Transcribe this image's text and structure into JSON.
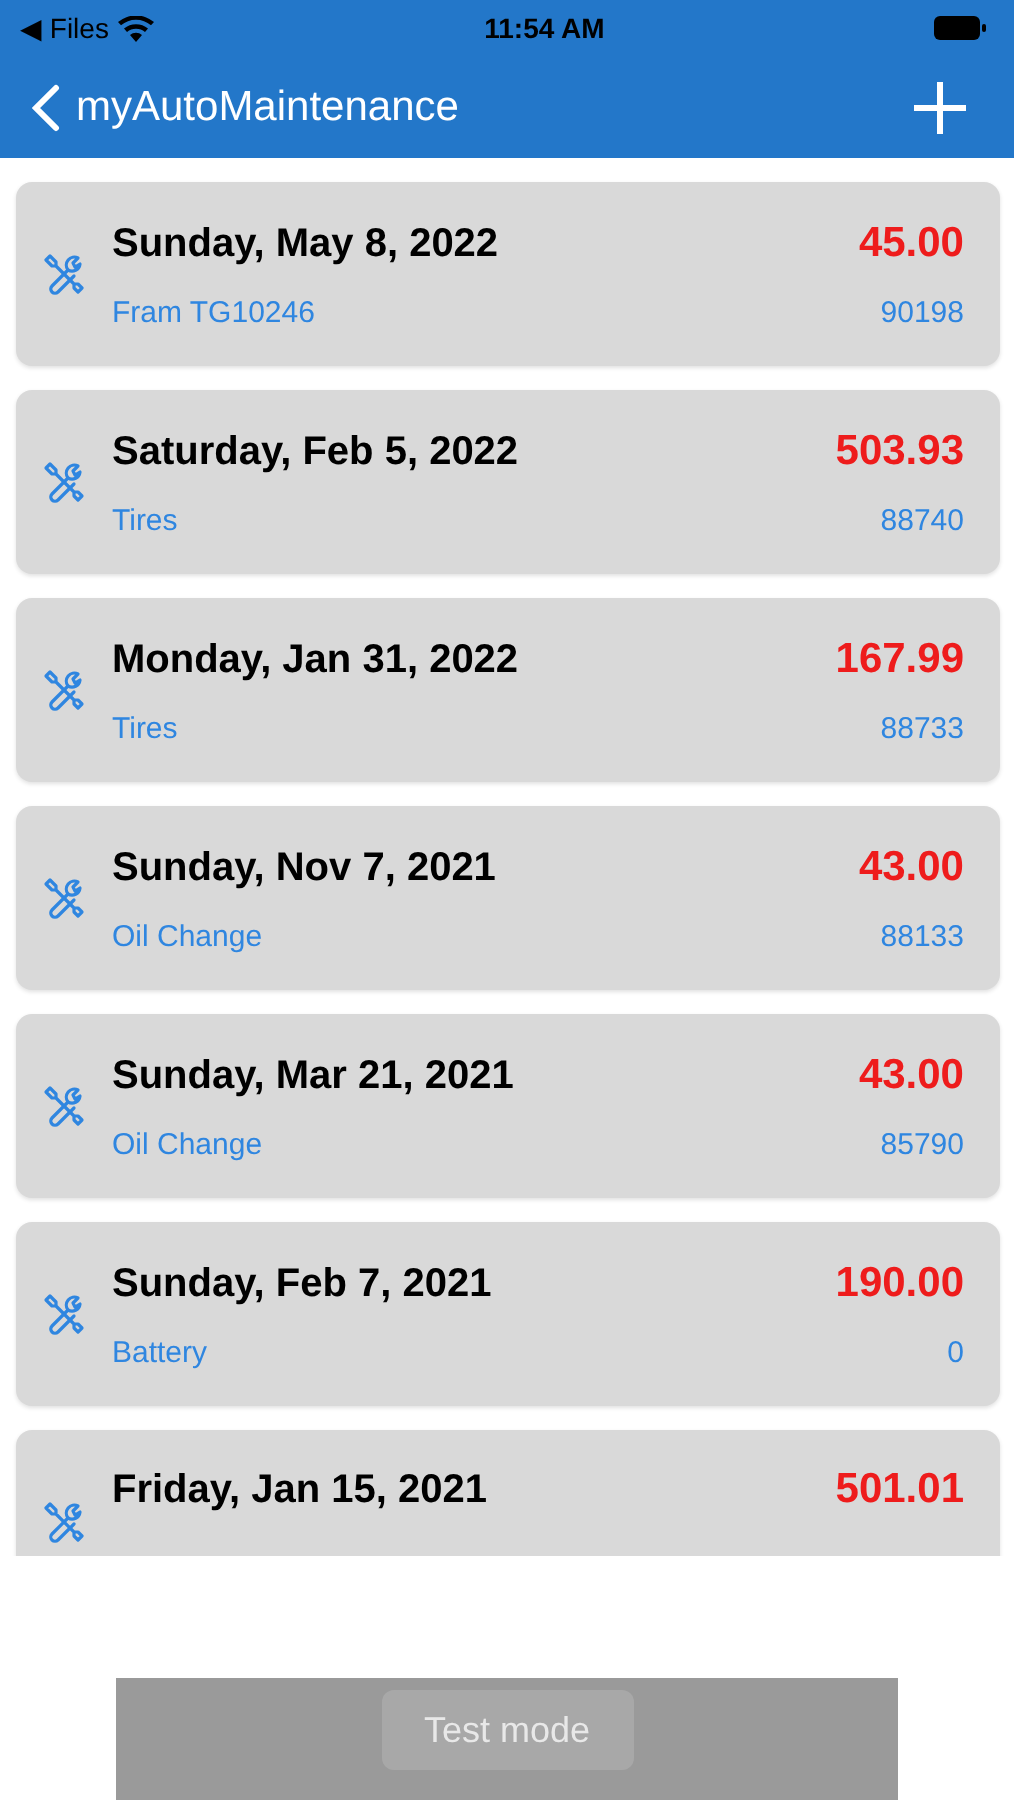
{
  "status_bar": {
    "back_app": "◀ Files",
    "time": "11:54 AM"
  },
  "nav": {
    "title": "myAutoMaintenance"
  },
  "entries": [
    {
      "date": "Sunday, May 8, 2022",
      "cost": "45.00",
      "description": "Fram TG10246",
      "mileage": "90198"
    },
    {
      "date": "Saturday, Feb 5, 2022",
      "cost": "503.93",
      "description": "Tires",
      "mileage": "88740"
    },
    {
      "date": "Monday, Jan 31, 2022",
      "cost": "167.99",
      "description": "Tires",
      "mileage": "88733"
    },
    {
      "date": "Sunday, Nov 7, 2021",
      "cost": "43.00",
      "description": "Oil Change",
      "mileage": "88133"
    },
    {
      "date": "Sunday, Mar 21, 2021",
      "cost": "43.00",
      "description": "Oil Change",
      "mileage": "85790"
    },
    {
      "date": "Sunday, Feb 7, 2021",
      "cost": "190.00",
      "description": "Battery",
      "mileage": "0"
    },
    {
      "date": "Friday, Jan 15, 2021",
      "cost": "501.01"
    }
  ],
  "ad_banner": {
    "label": "Test mode"
  }
}
